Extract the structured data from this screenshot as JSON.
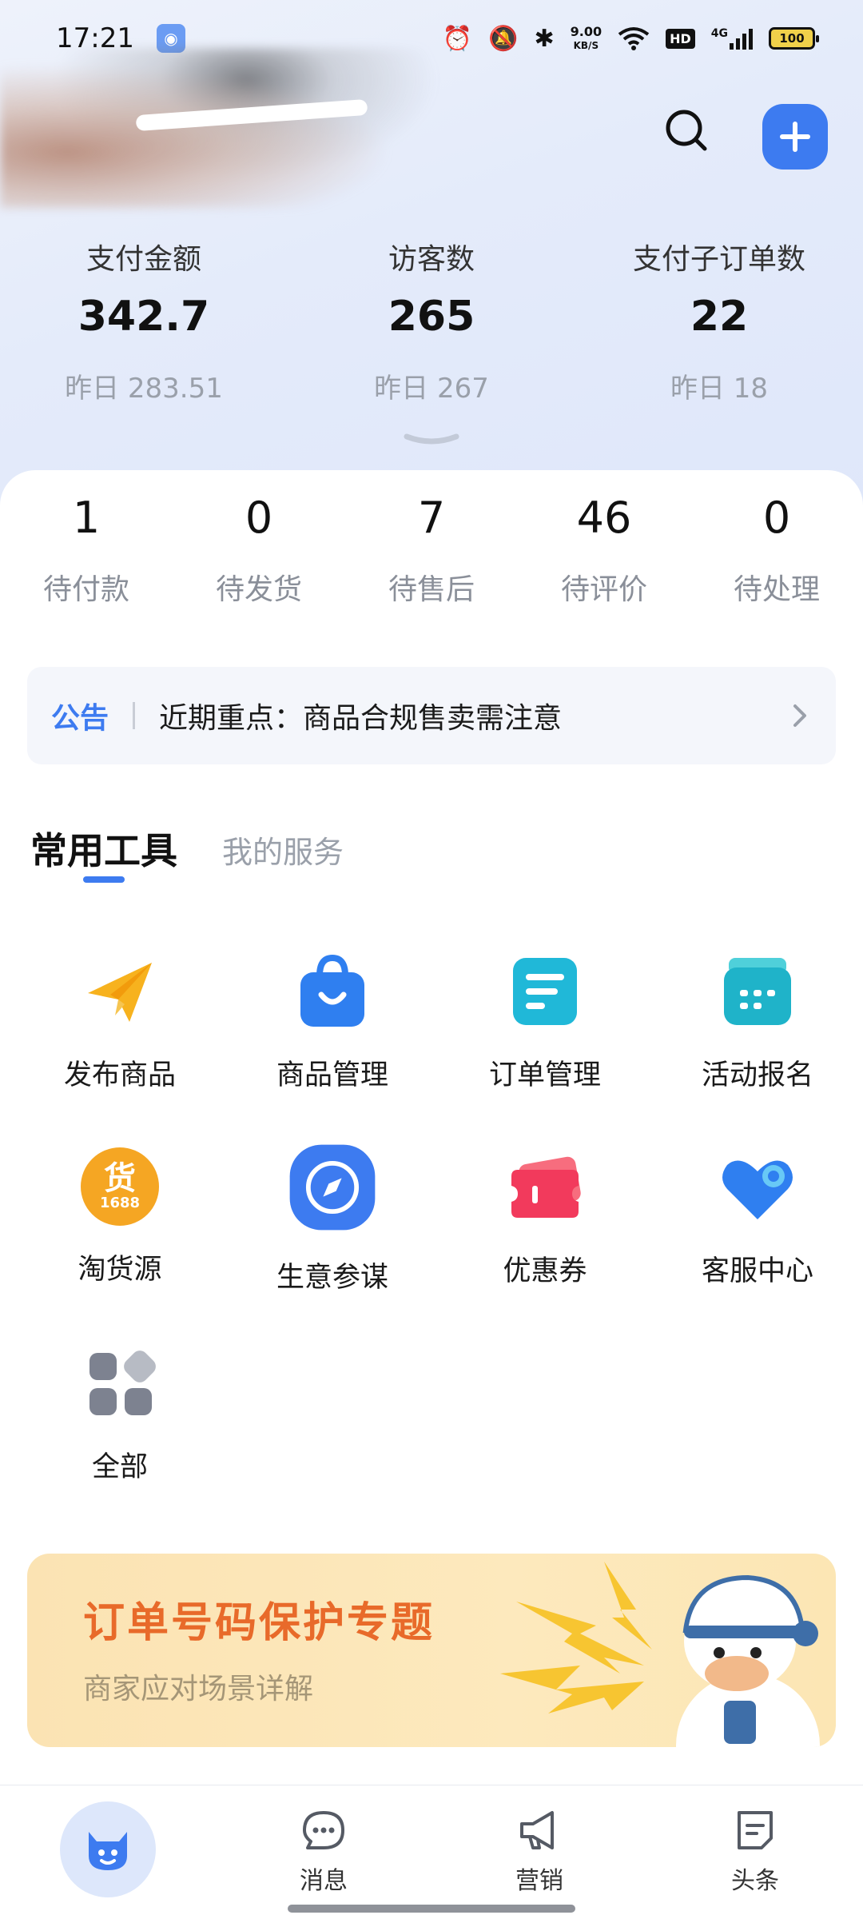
{
  "status_bar": {
    "time": "17:21",
    "net_speed_value": "9.00",
    "net_speed_unit": "KB/S",
    "hd": "HD",
    "network": "4G",
    "battery": "100",
    "icons": [
      "alarm-icon",
      "mute-icon",
      "bluetooth-icon",
      "wifi-icon",
      "signal-icon",
      "battery-icon"
    ]
  },
  "header": {
    "search_icon": "search-icon",
    "add_icon": "plus-icon"
  },
  "stats": [
    {
      "label": "支付金额",
      "value": "342.7",
      "prev": "昨日 283.51"
    },
    {
      "label": "访客数",
      "value": "265",
      "prev": "昨日 267"
    },
    {
      "label": "支付子订单数",
      "value": "22",
      "prev": "昨日 18"
    }
  ],
  "orders": [
    {
      "count": "1",
      "label": "待付款"
    },
    {
      "count": "0",
      "label": "待发货"
    },
    {
      "count": "7",
      "label": "待售后"
    },
    {
      "count": "46",
      "label": "待评价"
    },
    {
      "count": "0",
      "label": "待处理"
    }
  ],
  "notice": {
    "tag": "公告",
    "text": "近期重点：商品合规售卖需注意"
  },
  "tabs": {
    "active": "常用工具",
    "inactive": "我的服务"
  },
  "tools": [
    {
      "label": "发布商品",
      "icon": "paper-plane-icon"
    },
    {
      "label": "商品管理",
      "icon": "shopping-bag-icon"
    },
    {
      "label": "订单管理",
      "icon": "order-list-icon"
    },
    {
      "label": "活动报名",
      "icon": "activity-calendar-icon"
    },
    {
      "label": "淘货源",
      "icon": "1688-source-icon",
      "icon_text_top": "货",
      "icon_text_bottom": "1688"
    },
    {
      "label": "生意参谋",
      "icon": "compass-icon"
    },
    {
      "label": "优惠券",
      "icon": "coupon-icon"
    },
    {
      "label": "客服中心",
      "icon": "heart-service-icon"
    },
    {
      "label": "全部",
      "icon": "all-apps-icon"
    }
  ],
  "banner": {
    "title": "订单号码保护专题",
    "subtitle": "商家应对场景详解"
  },
  "bottom_nav": [
    {
      "label": "",
      "icon": "home-mascot-icon"
    },
    {
      "label": "消息",
      "icon": "chat-bubble-icon"
    },
    {
      "label": "营销",
      "icon": "megaphone-icon"
    },
    {
      "label": "头条",
      "icon": "headline-doc-icon"
    }
  ],
  "colors": {
    "accent": "#3d7bf0",
    "banner_title": "#e86a2a",
    "muted_text": "#9aa0aa"
  }
}
